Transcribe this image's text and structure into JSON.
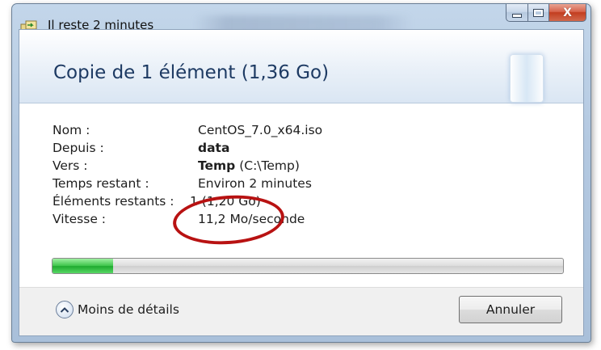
{
  "window": {
    "title": "Il reste 2 minutes",
    "caption_buttons": {
      "minimize": "–",
      "maximize": "□",
      "close": "X"
    }
  },
  "header": {
    "title": "Copie de 1 élément (1,36 Go)"
  },
  "details": [
    {
      "label": "Nom :",
      "value": "CentOS_7.0_x64.iso"
    },
    {
      "label": "Depuis :",
      "value": "data"
    },
    {
      "label": "Vers :",
      "value_bold": "Temp",
      "value_rest": "(C:\\Temp)"
    },
    {
      "label": "Temps restant :",
      "value": "Environ 2 minutes"
    },
    {
      "label": "Éléments restants :",
      "value": "1 (1,20 Go)"
    },
    {
      "label": "Vitesse :",
      "value": "11,2 Mo/seconde"
    }
  ],
  "progress": {
    "fraction": 0.118
  },
  "footer": {
    "details_toggle_label": "Moins de détails",
    "cancel_label": "Annuler"
  },
  "annotation": {
    "highlight_color": "#b81212"
  },
  "colors": {
    "progress_green": "#3cc44a",
    "title_blue": "#1d3a63"
  }
}
